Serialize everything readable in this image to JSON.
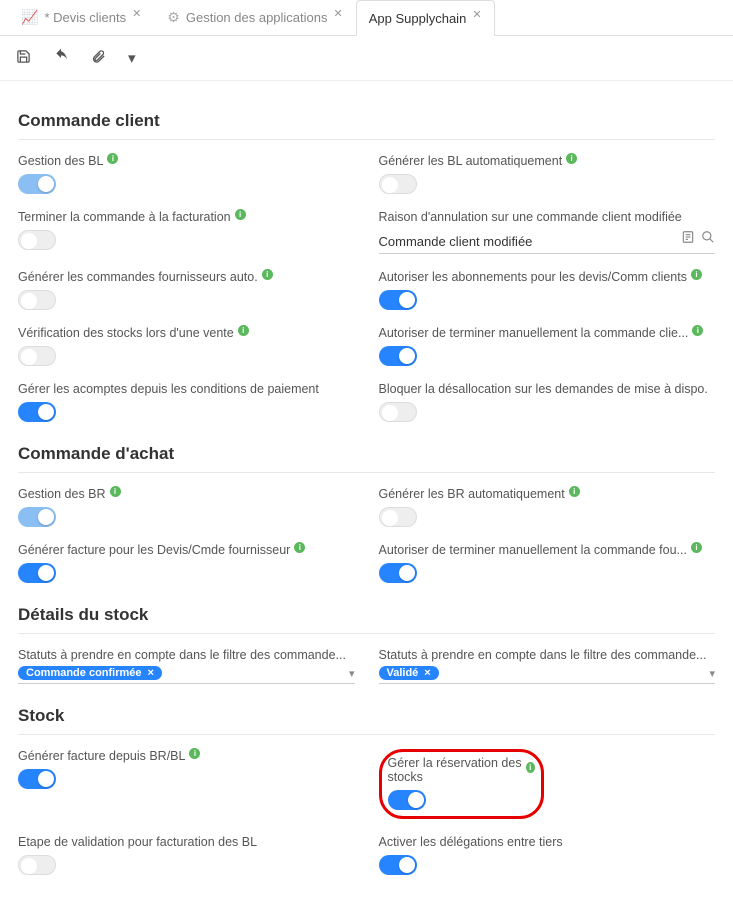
{
  "tabs": [
    {
      "label": "* Devis clients",
      "icon": "chart"
    },
    {
      "label": "Gestion des applications",
      "icon": "gear"
    },
    {
      "label": "App Supplychain",
      "icon": ""
    }
  ],
  "sections": {
    "cmd_client": {
      "title": "Commande client",
      "gestion_bl": "Gestion des BL",
      "gen_bl_auto": "Générer les BL automatiquement",
      "terminer_fact": "Terminer la commande à la facturation",
      "raison_annul_label": "Raison d'annulation sur une commande client modifiée",
      "raison_annul_value": "Commande client modifiée",
      "gen_cmdes_four": "Générer les commandes fournisseurs auto.",
      "auth_abonnements": "Autoriser les abonnements pour les devis/Comm clients",
      "verif_stocks": "Vérification des stocks lors d'une vente",
      "auth_terminer_man": "Autoriser de terminer manuellement la commande clie...",
      "gerer_acomptes": "Gérer les acomptes depuis les conditions de paiement",
      "bloquer_desalloc": "Bloquer la désallocation sur les demandes de mise à dispo."
    },
    "cmd_achat": {
      "title": "Commande d'achat",
      "gestion_br": "Gestion des BR",
      "gen_br_auto": "Générer les BR automatiquement",
      "gen_fact_devis_cmde": "Générer facture pour les Devis/Cmde fournisseur",
      "auth_terminer_man": "Autoriser de terminer manuellement la commande fou..."
    },
    "details_stock": {
      "title": "Détails du stock",
      "statuts_left_label": "Statuts à prendre en compte dans le filtre des commande...",
      "statuts_left_chip": "Commande confirmée",
      "statuts_right_label": "Statuts à prendre en compte dans le filtre des commande...",
      "statuts_right_chip": "Validé"
    },
    "stock": {
      "title": "Stock",
      "gen_fact_brbl": "Générer facture depuis BR/BL",
      "gerer_reserv": "Gérer la réservation des stocks",
      "etape_valid": "Etape de validation pour facturation des BL",
      "activer_deleg": "Activer les délégations entre tiers"
    }
  }
}
